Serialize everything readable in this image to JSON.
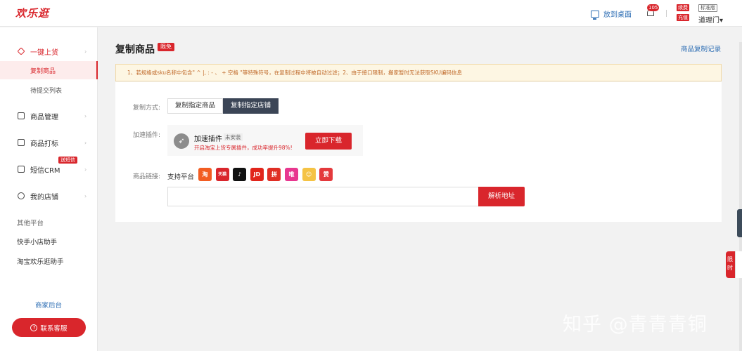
{
  "topbar": {
    "logo": "欢乐逛",
    "desk_label": "放到桌面",
    "notify_count": "105",
    "renew_label": "续费",
    "recharge_label": "充值",
    "edition_label": "标准版",
    "user_name": "道理门▾"
  },
  "sidebar": {
    "group_onekey": "一键上货",
    "sub_copy": "复制商品",
    "sub_pending": "待提交列表",
    "group_goods": "商品管理",
    "group_print": "商品打标",
    "group_sms": "短信CRM",
    "sms_badge": "送短信",
    "group_shop": "我的店铺",
    "other_title": "其他平台",
    "other_kuaishou": "快手小店助手",
    "other_taobao": "淘宝欢乐逛助手",
    "merchant_label": "商家后台",
    "contact_label": "联系客服",
    "chevron": "›"
  },
  "main": {
    "title": "复制商品",
    "limit_badge": "限免",
    "record_link": "商品复制记录",
    "notice": "1、若规格或sku名称中包含\" ^ |, : - 、 + 空格 \"等特殊符号，在复制过程中将被自动过滤；2、由于接口限制，搬家暂时无法获取SKU编码信息",
    "copy_mode_label": "复制方式:",
    "mode_specified_goods": "复制指定商品",
    "mode_specified_shop": "复制指定店铺",
    "plugin_label": "加速插件:",
    "plugin_name": "加速插件",
    "plugin_status": "未安装",
    "plugin_desc": "开启淘宝上货专属插件，成功率提升98%!",
    "download_btn": "立即下载",
    "link_label": "商品链接:",
    "support_label": "支持平台",
    "platforms": [
      {
        "glyph": "淘",
        "color": "#f25d22"
      },
      {
        "glyph": "天猫",
        "color": "#d9262c"
      },
      {
        "glyph": "♪",
        "color": "#111111"
      },
      {
        "glyph": "JD",
        "color": "#e1251b"
      },
      {
        "glyph": "拼",
        "color": "#e02e24"
      },
      {
        "glyph": "唯",
        "color": "#e8378f"
      },
      {
        "glyph": "☺",
        "color": "#f5c344"
      },
      {
        "glyph": "赞",
        "color": "#e4393c"
      }
    ],
    "url_placeholder": "",
    "parse_btn": "解析地址"
  },
  "side_tab": "限时",
  "watermark": "知乎 @青青青铜",
  "colors": {
    "accent": "#d9262c",
    "link": "#2b6cb3",
    "segment_active": "#3b4556"
  }
}
